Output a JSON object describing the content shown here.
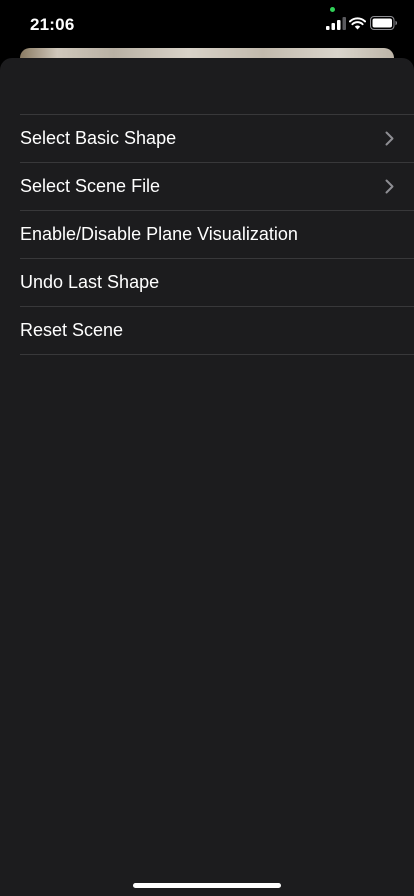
{
  "status_bar": {
    "time": "21:06",
    "camera_indicator_color": "#30d158"
  },
  "menu": {
    "items": [
      {
        "label": "Select Basic Shape",
        "has_chevron": true
      },
      {
        "label": "Select Scene File",
        "has_chevron": true
      },
      {
        "label": "Enable/Disable Plane Visualization",
        "has_chevron": false
      },
      {
        "label": "Undo Last Shape",
        "has_chevron": false
      },
      {
        "label": "Reset Scene",
        "has_chevron": false
      }
    ]
  },
  "colors": {
    "sheet_background": "#1c1c1e",
    "separator": "#38383a",
    "chevron": "#8e8e93"
  },
  "icons": [
    "signal-icon",
    "wifi-icon",
    "battery-icon",
    "chevron-right-icon"
  ]
}
